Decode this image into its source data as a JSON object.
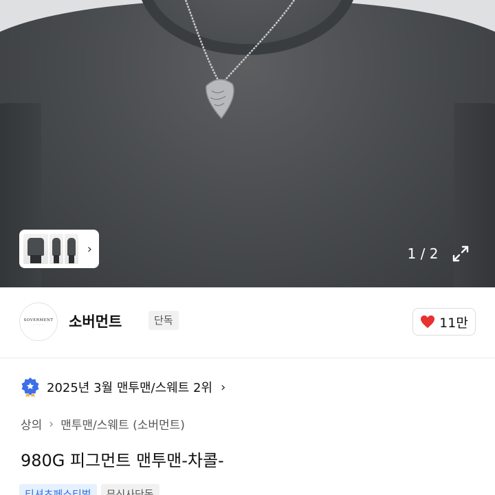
{
  "gallery": {
    "counter": "1 / 2",
    "thumb_arrow": "›",
    "icons": {
      "next": "chevron-right-icon",
      "expand": "expand-icon"
    }
  },
  "brand": {
    "logo_text": "SOVERMENT",
    "name": "소버먼트",
    "badge": "단독",
    "likes": "11만",
    "like_color": "#e8322f"
  },
  "ranking": {
    "text": "2025년 3월 맨투맨/스웨트 2위",
    "chevron": "›",
    "medal_color": "#3d6fe8"
  },
  "breadcrumb": {
    "items": [
      "상의",
      "맨투맨/스웨트 (소버먼트)"
    ],
    "separator": "›"
  },
  "product": {
    "title": "980G 피그먼트 맨투맨-차콜-"
  },
  "tags": [
    {
      "label": "티셔츠페스티벌",
      "style": "blue"
    },
    {
      "label": "무신사단독",
      "style": "grey"
    }
  ],
  "colors": {
    "accent_blue": "#2f6fe0",
    "garment": "#45484a"
  }
}
